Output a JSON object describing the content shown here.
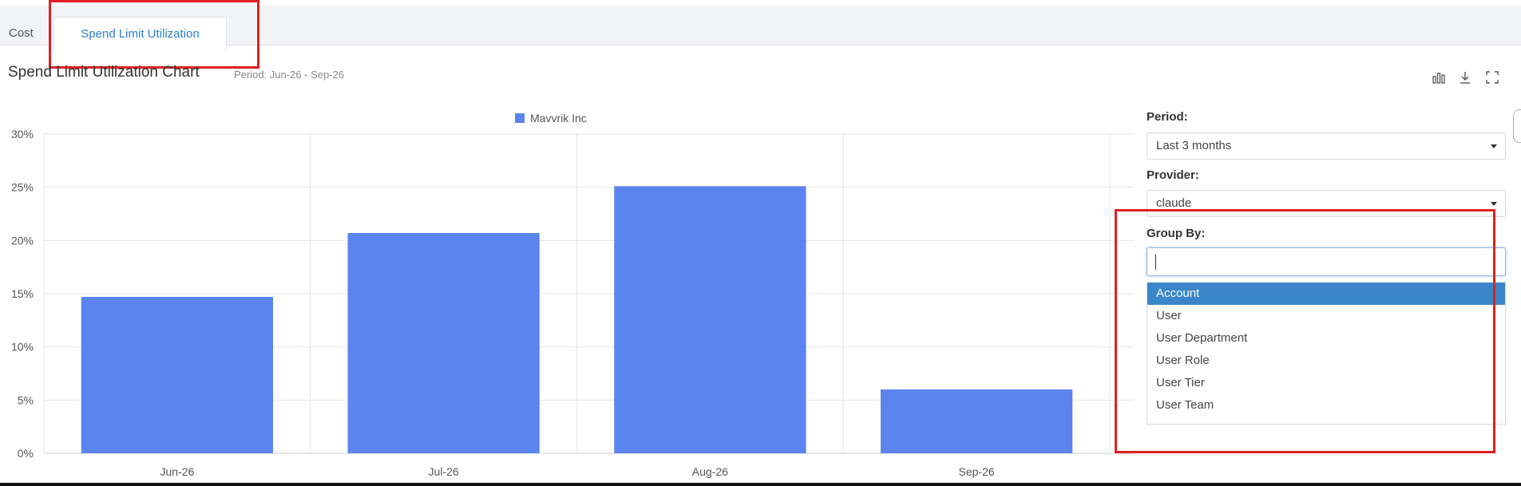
{
  "tabs": [
    {
      "label": "Cost",
      "active": false
    },
    {
      "label": "Spend Limit Utilization",
      "active": true
    }
  ],
  "header": {
    "title": "Spend Limit Utilization Chart",
    "period": "Period: Jun-26 - Sep-26",
    "tools": [
      "bar-chart-icon",
      "download-icon",
      "fullscreen-icon"
    ]
  },
  "filters": {
    "period": {
      "label": "Period:",
      "value": "Last 3 months"
    },
    "provider": {
      "label": "Provider:",
      "value": "claude"
    },
    "group_by": {
      "label": "Group By:",
      "search_value": "",
      "options": [
        "Account",
        "User",
        "User Department",
        "User Role",
        "User Tier",
        "User Team"
      ],
      "highlighted": "Account"
    }
  },
  "colors": {
    "bar": "#5b84ee",
    "highlight": "#3a86c8",
    "annotation": "#e02020",
    "active_tab_text": "#2a7fd4"
  },
  "chart_data": {
    "type": "bar",
    "categories": [
      "Jun-26",
      "Jul-26",
      "Aug-26",
      "Sep-26"
    ],
    "series": [
      {
        "name": "Mavvrik Inc",
        "values": [
          14.7,
          20.7,
          25.1,
          6.0
        ]
      }
    ],
    "ylim": [
      0,
      30
    ],
    "yticks": [
      "0%",
      "5%",
      "10%",
      "15%",
      "20%",
      "25%",
      "30%"
    ],
    "legend": "top-center",
    "grid": true
  }
}
